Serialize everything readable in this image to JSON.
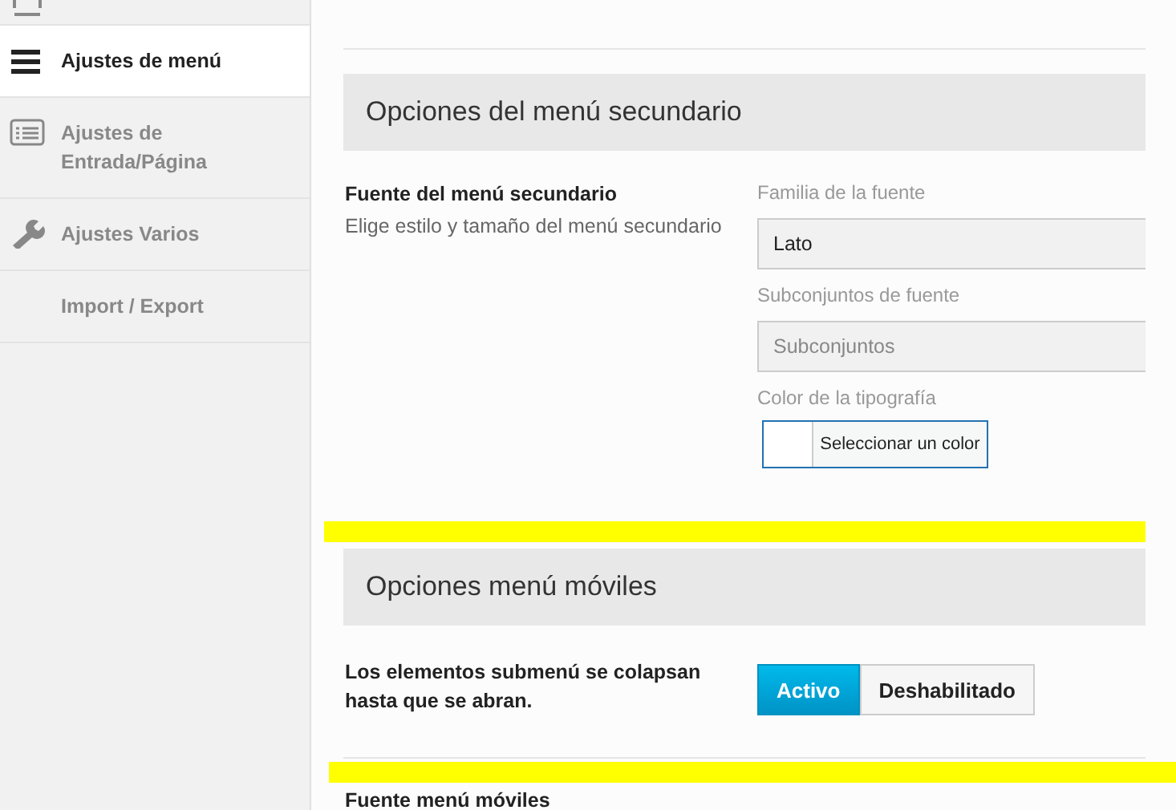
{
  "sidebar": {
    "items": [
      {
        "label": "Ajustes de menú",
        "kind": "menu",
        "selected": true
      },
      {
        "label": "Ajustes de Entrada/Página",
        "kind": "list",
        "selected": false
      },
      {
        "label": "Ajustes Varios",
        "kind": "wrench",
        "selected": false
      },
      {
        "label": "Import / Export",
        "kind": "plain",
        "selected": false
      }
    ]
  },
  "sections": [
    {
      "title": "Opciones del menú secundario",
      "rows": [
        {
          "kind": "font",
          "label": "Fuente del menú secundario",
          "description": "Elige estilo y tamaño del menú secundario",
          "fields": [
            {
              "kind": "select",
              "label": "Familia de la fuente",
              "value": "Lato"
            },
            {
              "kind": "select",
              "label": "Subconjuntos de fuente",
              "placeholder": "Subconjuntos"
            },
            {
              "kind": "color",
              "label": "Color de la tipografía",
              "button": "Seleccionar un color"
            }
          ]
        }
      ]
    },
    {
      "title": "Opciones menú móviles",
      "rows": [
        {
          "kind": "toggle",
          "label": "Los elementos submenú se colapsan hasta que se abran.",
          "options": [
            {
              "label": "Activo",
              "selected": true
            },
            {
              "label": "Deshabilitado",
              "selected": false
            }
          ]
        },
        {
          "kind": "font",
          "label": "Fuente menú móviles"
        }
      ]
    }
  ]
}
